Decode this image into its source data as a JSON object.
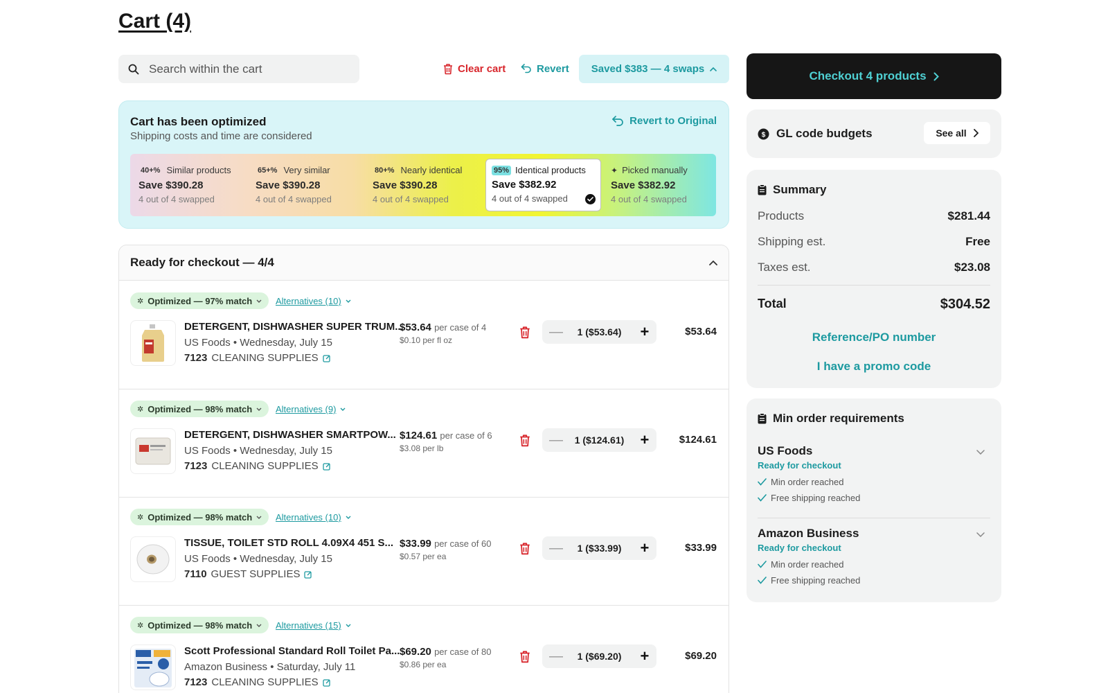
{
  "page": {
    "title": "Cart (4)"
  },
  "toolbar": {
    "search_placeholder": "Search within the cart",
    "clear_cart": "Clear cart",
    "revert": "Revert",
    "saved_pill": "Saved $383 — 4 swaps"
  },
  "optimized": {
    "title": "Cart has been optimized",
    "subtitle": "Shipping costs and time are considered",
    "revert_original": "Revert to Original",
    "tiers": [
      {
        "pct": "40+%",
        "label": "Similar products",
        "save": "Save $390.28",
        "swapped": "4 out of 4 swapped"
      },
      {
        "pct": "65+%",
        "label": "Very similar",
        "save": "Save $390.28",
        "swapped": "4 out of 4 swapped"
      },
      {
        "pct": "80+%",
        "label": "Nearly identical",
        "save": "Save $390.28",
        "swapped": "4 out of 4 swapped"
      },
      {
        "pct": "95%",
        "label": "Identical products",
        "save": "Save $382.92",
        "swapped": "4 out of 4 swapped",
        "selected": true
      },
      {
        "pct": "✦",
        "label": "Picked manually",
        "save": "Save $382.92",
        "swapped": "4 out of 4 swapped"
      }
    ]
  },
  "list": {
    "header": "Ready for checkout — 4/4",
    "items": [
      {
        "match": "Optimized — 97% match",
        "alternatives": "Alternatives (10)",
        "name": "DETERGENT, DISHWASHER SUPER TRUM...",
        "vendor": "US Foods • Wednesday, July 15",
        "gl_code": "7123",
        "gl_name": "CLEANING SUPPLIES",
        "price": "$53.64",
        "pack": "per case of 4",
        "unit": "$0.10 per fl oz",
        "qty": "1 ($53.64)",
        "total": "$53.64",
        "thumb": "jug-icon"
      },
      {
        "match": "Optimized — 98% match",
        "alternatives": "Alternatives (9)",
        "name": "DETERGENT, DISHWASHER SMARTPOW...",
        "vendor": "US Foods • Wednesday, July 15",
        "gl_code": "7123",
        "gl_name": "CLEANING SUPPLIES",
        "price": "$124.61",
        "pack": "per case of 6",
        "unit": "$3.08 per lb",
        "qty": "1 ($124.61)",
        "total": "$124.61",
        "thumb": "tub-icon"
      },
      {
        "match": "Optimized — 98% match",
        "alternatives": "Alternatives (10)",
        "name": "TISSUE, TOILET STD ROLL 4.09X4 451 S...",
        "vendor": "US Foods • Wednesday, July 15",
        "gl_code": "7110",
        "gl_name": "GUEST SUPPLIES",
        "price": "$33.99",
        "pack": "per case of 60",
        "unit": "$0.57 per ea",
        "qty": "1 ($33.99)",
        "total": "$33.99",
        "thumb": "toilet-roll-icon"
      },
      {
        "match": "Optimized — 98% match",
        "alternatives": "Alternatives (15)",
        "name": "Scott Professional Standard Roll Toilet Pa...",
        "vendor": "Amazon Business • Saturday, July 11",
        "gl_code": "7123",
        "gl_name": "CLEANING SUPPLIES",
        "price": "$69.20",
        "pack": "per case of 80",
        "unit": "$0.86 per ea",
        "qty": "1 ($69.20)",
        "total": "$69.20",
        "thumb": "tissue-pack-icon"
      }
    ]
  },
  "checkout": {
    "label": "Checkout 4 products"
  },
  "gl_budgets": {
    "title": "GL code budgets",
    "see_all": "See all"
  },
  "summary": {
    "title": "Summary",
    "rows": [
      {
        "k": "Products",
        "v": "$281.44"
      },
      {
        "k": "Shipping est.",
        "v": "Free"
      },
      {
        "k": "Taxes est.",
        "v": "$23.08"
      }
    ],
    "total_label": "Total",
    "total_value": "$304.52",
    "reference": "Reference/PO number",
    "promo": "I have a promo code"
  },
  "min_order": {
    "title": "Min order requirements",
    "vendors": [
      {
        "name": "US Foods",
        "status": "Ready for checkout",
        "checks": [
          "Min order reached",
          "Free shipping reached"
        ]
      },
      {
        "name": "Amazon Business",
        "status": "Ready for checkout",
        "checks": [
          "Min order reached",
          "Free shipping reached"
        ]
      }
    ]
  },
  "colors": {
    "accent": "#1d9aa0",
    "danger": "#d8262c",
    "match_pill": "#dbf4dd",
    "checkout_bg": "#161616",
    "checkout_text": "#4fd0d3"
  }
}
